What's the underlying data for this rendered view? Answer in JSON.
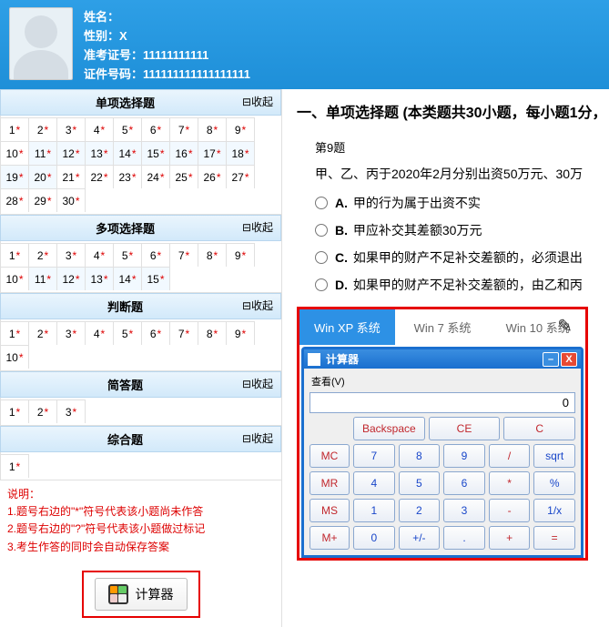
{
  "header": {
    "name_label": "姓名：",
    "name_value": "",
    "gender_label": "性别：",
    "gender_value": "X",
    "ticket_label": "准考证号：",
    "ticket_value": "11111111111",
    "id_label": "证件号码：",
    "id_value": "111111111111111111"
  },
  "collapse_label": "收起",
  "sections": {
    "single": {
      "title": "单项选择题",
      "count": 30
    },
    "multi": {
      "title": "多项选择题",
      "count": 15
    },
    "judge": {
      "title": "判断题",
      "count": 10
    },
    "short": {
      "title": "简答题",
      "count": 3
    },
    "comp": {
      "title": "综合题",
      "count": 1
    }
  },
  "notes": {
    "label": "说明：",
    "line1": "1.题号右边的\"*\"符号代表该小题尚未作答",
    "line2": "2.题号右边的\"?\"符号代表该小题做过标记",
    "line3": "3.考生作答的同时会自动保存答案"
  },
  "calc_button": "计算器",
  "question": {
    "heading": "一、单项选择题 (本类题共30小题，每小题1分，",
    "number": "第9题",
    "stem": "甲、乙、丙于2020年2月分别出资50万元、30万",
    "options": {
      "A": "甲的行为属于出资不实",
      "B": "甲应补交其差额30万元",
      "C": "如果甲的财产不足补交差额的，必须退出",
      "D": "如果甲的财产不足补交差额的，由乙和丙"
    }
  },
  "tabs": {
    "xp": "Win XP 系统",
    "win7": "Win 7 系统",
    "win10": "Win 10 系统"
  },
  "xp": {
    "title": "计算器",
    "menu": "查看(V)",
    "display": "0",
    "backspace": "Backspace",
    "ce": "CE",
    "c": "C",
    "mc": "MC",
    "mr": "MR",
    "ms": "MS",
    "mp": "M+",
    "k7": "7",
    "k8": "8",
    "k9": "9",
    "div": "/",
    "sqrt": "sqrt",
    "k4": "4",
    "k5": "5",
    "k6": "6",
    "mul": "*",
    "pct": "%",
    "k1": "1",
    "k2": "2",
    "k3": "3",
    "sub": "-",
    "inv": "1/x",
    "k0": "0",
    "pm": "+/-",
    "dot": ".",
    "add": "+",
    "eq": "="
  }
}
